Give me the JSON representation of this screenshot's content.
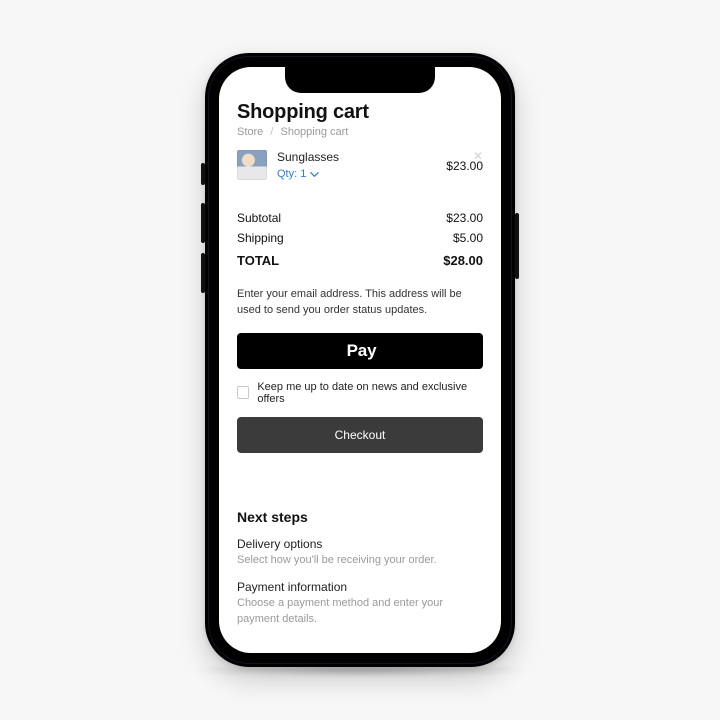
{
  "page": {
    "title": "Shopping cart",
    "breadcrumb": {
      "a": "Store",
      "b": "Shopping cart"
    }
  },
  "item": {
    "name": "Sunglasses",
    "qty_label": "Qty: 1",
    "price": "$23.00"
  },
  "summary": {
    "subtotal_label": "Subtotal",
    "subtotal_value": "$23.00",
    "shipping_label": "Shipping",
    "shipping_value": "$5.00",
    "total_label": "TOTAL",
    "total_value": "$28.00"
  },
  "email_note": "Enter your email address. This address will be used to send you order status updates.",
  "applepay": {
    "word": "Pay"
  },
  "consent_label": "Keep me up to date on news and exclusive offers",
  "checkout_label": "Checkout",
  "next": {
    "heading": "Next steps",
    "steps": [
      {
        "title": "Delivery options",
        "desc": "Select how you'll be receiving your order."
      },
      {
        "title": "Payment information",
        "desc": "Choose a payment method and enter your payment details."
      }
    ]
  }
}
